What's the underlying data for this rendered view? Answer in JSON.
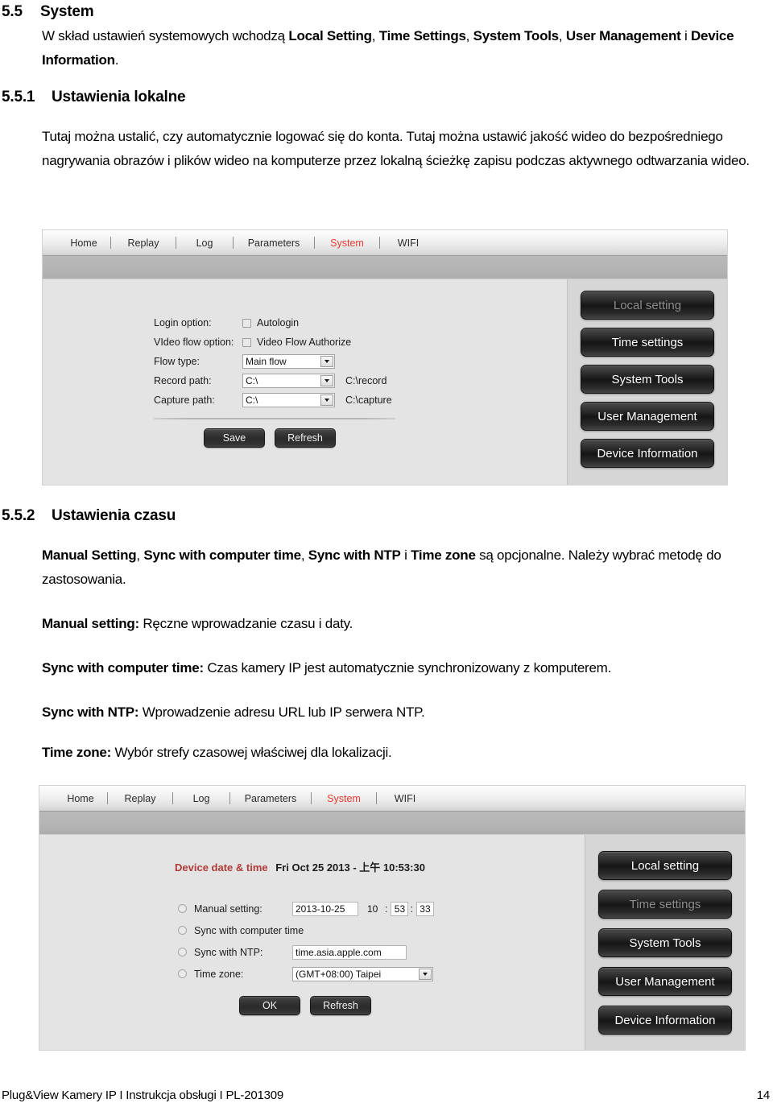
{
  "document": {
    "section_55": {
      "number": "5.5",
      "title": "System",
      "paragraph_html": "W skład ustawień systemowych wchodzą <b>Local Setting</b>, <b>Time Settings</b>, <b>System Tools</b>, <b>User Management</b> i <b>Device Information</b>."
    },
    "section_551": {
      "number": "5.5.1",
      "title": "Ustawienia lokalne",
      "paragraph_html": "Tutaj można ustalić, czy automatycznie logować się do konta. Tutaj można ustawić jakość wideo do bezpośredniego nagrywania obrazów i plików wideo na komputerze przez lokalną ścieżkę zapisu podczas aktywnego odtwarzania wideo."
    },
    "section_552": {
      "number": "5.5.2",
      "title": "Ustawienia czasu",
      "paragraph1_html": "<b>Manual Setting</b>, <b>Sync with computer time</b>, <b>Sync with NTP</b> i <b>Time zone</b> są opcjonalne. Należy wybrać metodę do zastosowania.",
      "paragraph2_html": "<b>Manual setting:</b> Ręczne wprowadzanie czasu i daty.",
      "paragraph3_html": "<b>Sync with computer time:</b> Czas kamery IP jest automatycznie synchronizowany z komputerem.",
      "paragraph4_html": "<b>Sync with NTP:</b> Wprowadzenie adresu URL lub IP serwera NTP.",
      "paragraph5_html": "<b>Time zone:</b> Wybór strefy czasowej właściwej dla lokalizacji."
    },
    "footer": {
      "left": "Plug&View Kamery IP I Instrukcja obsługi I PL-201309",
      "page_number": "14"
    }
  },
  "screenshot_local_setting": {
    "nav": {
      "items": [
        {
          "label": "Home",
          "active": false
        },
        {
          "label": "Replay",
          "active": false
        },
        {
          "label": "Log",
          "active": false
        },
        {
          "label": "Parameters",
          "active": false
        },
        {
          "label": "System",
          "active": true
        },
        {
          "label": "WIFI",
          "active": false
        }
      ],
      "active_color": "#e8392f"
    },
    "form": {
      "login_option_label": "Login option:",
      "autologin_label": "Autologin",
      "autologin_checked": false,
      "video_flow_option_label": "VIdeo flow option:",
      "video_flow_authorize_label": "Video Flow Authorize",
      "video_flow_authorize_checked": false,
      "flow_type_label": "Flow type:",
      "flow_type_value": "Main flow",
      "record_path_label": "Record path:",
      "record_path_value": "C:\\",
      "record_path_hint": "C:\\record",
      "capture_path_label": "Capture path:",
      "capture_path_value": "C:\\",
      "capture_path_hint": "C:\\capture",
      "save_label": "Save",
      "refresh_label": "Refresh"
    },
    "sidebar": {
      "buttons": [
        {
          "label": "Local setting",
          "active": true
        },
        {
          "label": "Time settings",
          "active": false
        },
        {
          "label": "System Tools",
          "active": false
        },
        {
          "label": "User Management",
          "active": false
        },
        {
          "label": "Device Information",
          "active": false
        }
      ]
    }
  },
  "screenshot_time_settings": {
    "nav": {
      "items": [
        {
          "label": "Home",
          "active": false
        },
        {
          "label": "Replay",
          "active": false
        },
        {
          "label": "Log",
          "active": false
        },
        {
          "label": "Parameters",
          "active": false
        },
        {
          "label": "System",
          "active": true
        },
        {
          "label": "WIFI",
          "active": false
        }
      ]
    },
    "device_datetime": {
      "label": "Device date & time",
      "value": "Fri Oct 25 2013 - 上午 10:53:30",
      "label_color": "#b03a36"
    },
    "form": {
      "manual_setting_label": "Manual setting:",
      "manual_setting_selected": false,
      "manual_date_value": "2013-10-25",
      "manual_hour_value": "10",
      "manual_minute_value": "53",
      "manual_second_value": "33",
      "time_separator": ":",
      "sync_computer_label": "Sync with computer time",
      "sync_computer_selected": false,
      "sync_ntp_label": "Sync with NTP:",
      "sync_ntp_selected": false,
      "sync_ntp_value": "time.asia.apple.com",
      "time_zone_label": "Time zone:",
      "time_zone_selected": false,
      "time_zone_value": "(GMT+08:00) Taipei",
      "ok_label": "OK",
      "refresh_label": "Refresh"
    },
    "sidebar": {
      "buttons": [
        {
          "label": "Local setting",
          "active": false
        },
        {
          "label": "Time settings",
          "active": true
        },
        {
          "label": "System Tools",
          "active": false
        },
        {
          "label": "User Management",
          "active": false
        },
        {
          "label": "Device Information",
          "active": false
        }
      ]
    }
  }
}
